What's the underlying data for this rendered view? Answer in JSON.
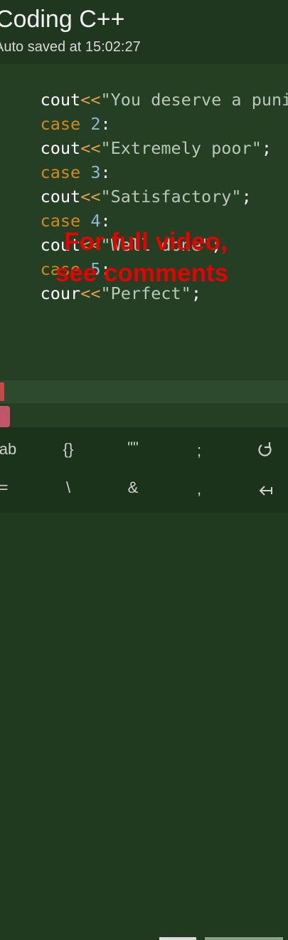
{
  "header": {
    "title": "Coding C++",
    "autosave": "Auto saved at 15:02:27"
  },
  "code": {
    "lines": [
      {
        "kind": "cout",
        "op": "<<",
        "str": "\"You deserve a punish",
        "end": ""
      },
      {
        "kind": "case",
        "kw": "case",
        "num": "2",
        "end": ":"
      },
      {
        "kind": "cout",
        "op": "<<",
        "str": "\"Extremely poor\"",
        "end": ";"
      },
      {
        "kind": "case",
        "kw": "case",
        "num": "3",
        "end": ":"
      },
      {
        "kind": "cout",
        "op": "<<",
        "str": "\"Satisfactory\"",
        "end": ";"
      },
      {
        "kind": "case",
        "kw": "case",
        "num": "4",
        "end": ":"
      },
      {
        "kind": "cout",
        "op": "<<",
        "str": "\"Well done\"",
        "end": ";"
      },
      {
        "kind": "case",
        "kw": "case",
        "num": "5",
        "end": ":"
      },
      {
        "kind": "cout",
        "ident": "cour",
        "op": "<<",
        "str": "\"Perfect\"",
        "end": ";"
      }
    ],
    "ident": "cout"
  },
  "overlay": {
    "line1": "For full video,",
    "line2": "see comments"
  },
  "keybar": {
    "row1": [
      "ab",
      "{}",
      "\"\"",
      ";",
      "undo-icon"
    ],
    "row2": [
      "=",
      "\\",
      "&",
      ",",
      "backspace-icon"
    ]
  },
  "colors": {
    "background": "#1f3a1f",
    "overlay_text": "#e60000",
    "keyword": "#d2891f"
  }
}
